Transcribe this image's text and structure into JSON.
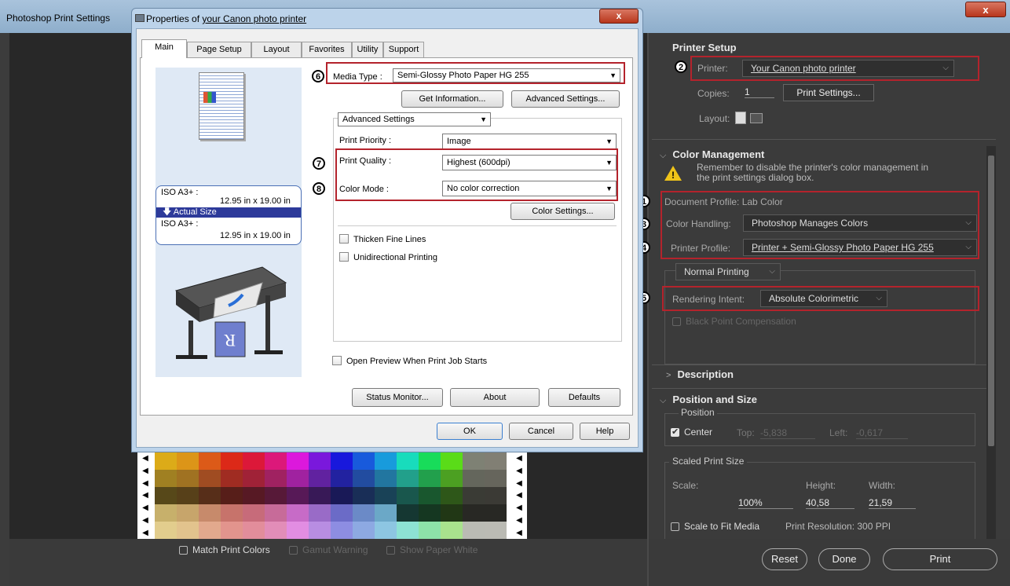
{
  "photoshop": {
    "window_title": "Photoshop Print Settings",
    "close_label": "x",
    "preview_options": {
      "match_print_colors": "Match Print Colors",
      "gamut_warning": "Gamut Warning",
      "show_paper_white": "Show Paper White"
    },
    "printer_setup": {
      "heading": "Printer Setup",
      "printer_label": "Printer:",
      "printer_value": "Your Canon photo printer",
      "copies_label": "Copies:",
      "copies_value": "1",
      "print_settings_button": "Print Settings...",
      "layout_label": "Layout:"
    },
    "color_management": {
      "heading": "Color Management",
      "warning": "Remember to disable the printer's color management in the print settings dialog box.",
      "document_profile": "Document Profile: Lab Color",
      "color_handling_label": "Color Handling:",
      "color_handling_value": "Photoshop Manages Colors",
      "printer_profile_label": "Printer Profile:",
      "printer_profile_value": "Printer + Semi-Glossy Photo Paper HG 255",
      "normal_printing": "Normal Printing",
      "rendering_intent_label": "Rendering Intent:",
      "rendering_intent_value": "Absolute Colorimetric",
      "black_point": "Black Point Compensation"
    },
    "description_heading": "Description",
    "position_size": {
      "heading": "Position and Size",
      "position_legend": "Position",
      "center_label": "Center",
      "top_label": "Top:",
      "top_value": "-5,838",
      "left_label": "Left:",
      "left_value": "-0,617",
      "scaled_legend": "Scaled Print Size",
      "scale_label": "Scale:",
      "height_label": "Height:",
      "width_label": "Width:",
      "scale_value": "100%",
      "height_value": "40,58",
      "width_value": "21,59",
      "scale_to_fit": "Scale to Fit Media",
      "print_resolution": "Print Resolution: 300 PPI"
    },
    "buttons": {
      "reset": "Reset",
      "done": "Done",
      "print": "Print"
    }
  },
  "canon_dialog": {
    "title_prefix": "Properties of ",
    "title_link": "your Canon photo printer",
    "close_label": "x",
    "tabs": [
      "Main",
      "Page Setup",
      "Layout",
      "Favorites",
      "Utility",
      "Support"
    ],
    "media_type_label": "Media Type :",
    "media_type_value": "Semi-Glossy Photo Paper HG 255",
    "get_information_button": "Get Information...",
    "advanced_settings_button": "Advanced Settings...",
    "advanced_settings_dropdown": "Advanced Settings",
    "print_priority_label": "Print Priority :",
    "print_priority_value": "Image",
    "print_quality_label": "Print Quality :",
    "print_quality_value": "Highest (600dpi)",
    "color_mode_label": "Color Mode :",
    "color_mode_value": "No color correction",
    "color_settings_button": "Color Settings...",
    "thicken_fine_lines": "Thicken Fine Lines",
    "unidirectional_printing": "Unidirectional Printing",
    "open_preview": "Open Preview When Print Job Starts",
    "paper_box": {
      "size1_name": "ISO A3+ :",
      "size1_dims": "12.95 in x 19.00 in",
      "actual_size": "Actual Size",
      "size2_name": "ISO A3+ :",
      "size2_dims": "12.95 in x 19.00 in"
    },
    "status_monitor_button": "Status Monitor...",
    "about_button": "About",
    "defaults_button": "Defaults",
    "ok_button": "OK",
    "cancel_button": "Cancel",
    "help_button": "Help"
  },
  "callouts": [
    "1",
    "2",
    "3",
    "4",
    "5",
    "6",
    "7",
    "8"
  ],
  "colors": {
    "callout_border": "#b4232c",
    "ps_panel": "#3b3b3b",
    "dialog_frame": "#bcd3ea"
  }
}
